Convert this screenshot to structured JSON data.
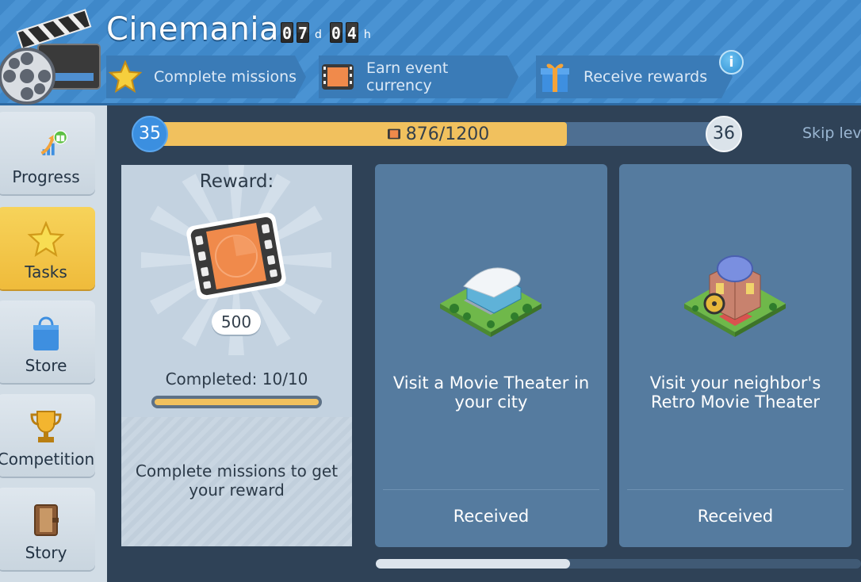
{
  "header": {
    "title": "Cinemania",
    "timer": {
      "d1": "0",
      "d2": "7",
      "d_unit": "d",
      "h1": "0",
      "h2": "4",
      "h_unit": "h"
    },
    "steps": [
      {
        "label": "Complete missions",
        "icon": "star-icon"
      },
      {
        "label": "Earn event currency",
        "icon": "film-ticket-icon"
      },
      {
        "label": "Receive rewards",
        "icon": "gift-icon"
      }
    ],
    "info_label": "i"
  },
  "sidebar": {
    "items": [
      {
        "label": "Progress",
        "icon": "progress-arrow-icon",
        "active": false
      },
      {
        "label": "Tasks",
        "icon": "star-icon",
        "active": true
      },
      {
        "label": "Store",
        "icon": "shopping-bag-icon",
        "active": false
      },
      {
        "label": "Competition",
        "icon": "trophy-icon",
        "active": false
      },
      {
        "label": "Story",
        "icon": "book-icon",
        "active": false
      }
    ]
  },
  "progress": {
    "current_level": "35",
    "next_level": "36",
    "points_text": "876/1200",
    "current_points": 876,
    "required_points": 1200,
    "skip_label": "Skip leve"
  },
  "reward": {
    "title": "Reward:",
    "amount": "500",
    "completed_text": "Completed: 10/10",
    "completed_fraction": 1.0,
    "description": "Complete missions to get your reward"
  },
  "tasks": [
    {
      "text": "Visit a Movie Theater in your city",
      "status": "Received",
      "icon": "movie-theater-building-icon"
    },
    {
      "text": "Visit your neighbor's Retro Movie Theater",
      "status": "Received",
      "icon": "retro-theater-building-icon"
    }
  ],
  "colors": {
    "accent_yellow": "#f1c15e",
    "header_blue": "#3f88c9",
    "card_blue": "#557b9f",
    "level_blue": "#3b8fe0"
  }
}
